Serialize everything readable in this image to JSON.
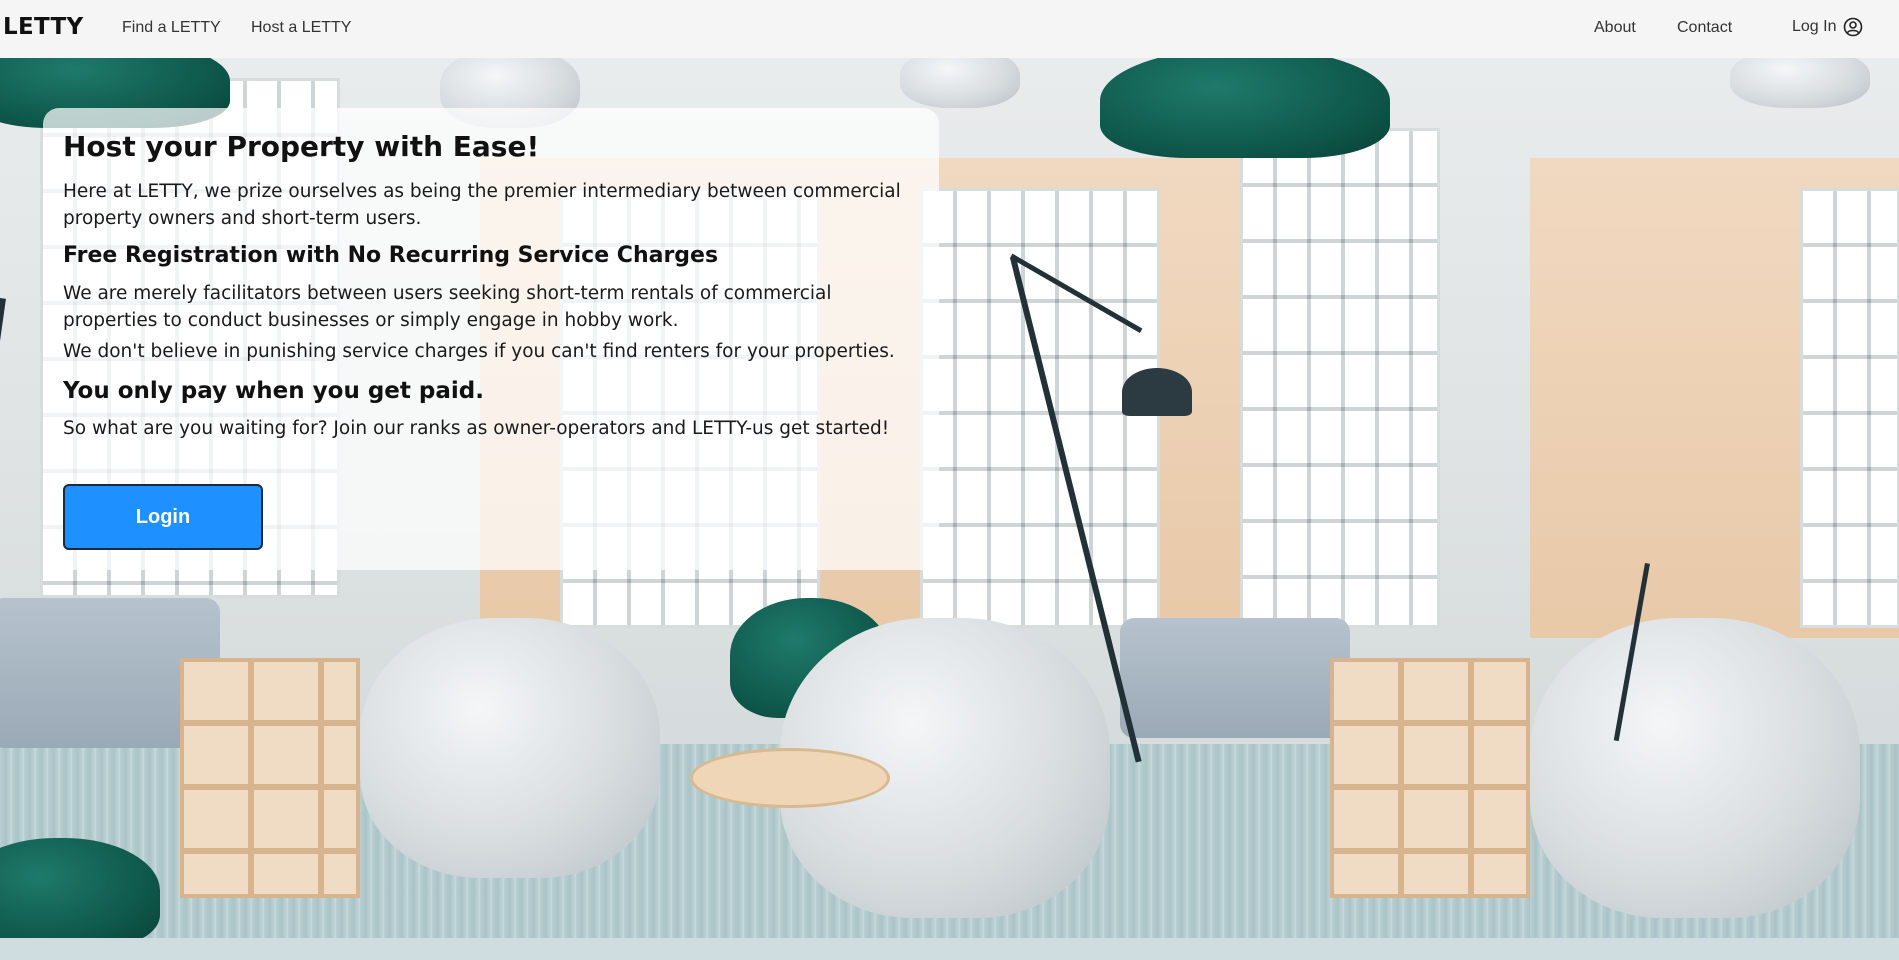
{
  "navbar": {
    "brand": "LETTY",
    "links": {
      "find": "Find a LETTY",
      "host": "Host a LETTY",
      "about": "About",
      "contact": "Contact",
      "login": "Log In"
    },
    "login_icon": "user-circle-icon"
  },
  "hero": {
    "background": "office-interior-photo-tiled"
  },
  "card": {
    "title": "Host your Property with Ease!",
    "intro": "Here at LETTY, we prize ourselves as being the premier intermediary between commercial property owners and short-term users.",
    "subtitle": "Free Registration with No Recurring Service Charges",
    "paragraph1": "We are merely facilitators between users seeking short-term rentals of commercial properties to conduct businesses or simply engage in hobby work.",
    "paragraph2": "We don't believe in punishing service charges if you can't find renters for your properties.",
    "tagline": "You only pay when you get paid.",
    "cta_text": "So what are you waiting for? Join our ranks as owner-operators and LETTY-us get started!",
    "login_button": "Login"
  },
  "colors": {
    "navbar_bg": "#f5f5f5",
    "button_bg": "#1e90ff",
    "button_text": "#ffffff"
  }
}
